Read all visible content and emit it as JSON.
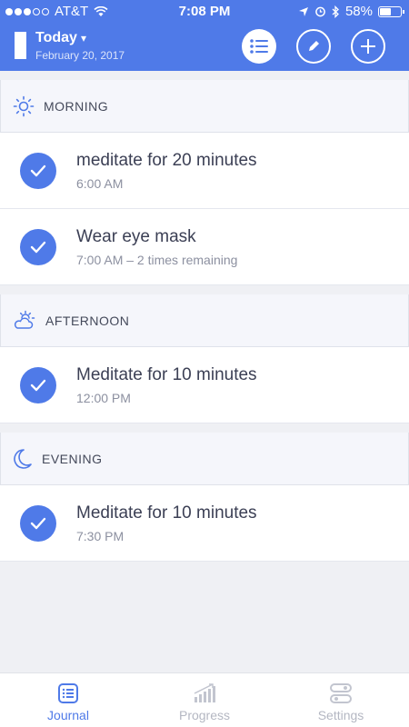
{
  "status": {
    "carrier": "AT&T",
    "time": "7:08 PM",
    "battery": "58%",
    "battery_level": 0.58
  },
  "header": {
    "title": "Today",
    "dropdown_glyph": "▾",
    "date": "February 20, 2017",
    "buttons": [
      "list-icon",
      "edit-icon",
      "add-icon"
    ]
  },
  "sections": [
    {
      "title": "MORNING",
      "icon": "sun-icon",
      "items": [
        {
          "title": "meditate for 20 minutes",
          "sub": "6:00 AM"
        },
        {
          "title": "Wear eye mask",
          "sub": "7:00 AM – 2 times remaining"
        }
      ]
    },
    {
      "title": "AFTERNOON",
      "icon": "partly-cloudy-icon",
      "items": [
        {
          "title": "Meditate for 10 minutes",
          "sub": "12:00 PM"
        }
      ]
    },
    {
      "title": "EVENING",
      "icon": "moon-icon",
      "items": [
        {
          "title": "Meditate for 10 minutes",
          "sub": "7:30 PM"
        }
      ]
    }
  ],
  "tabs": [
    {
      "label": "Journal",
      "icon": "journal-icon",
      "active": true
    },
    {
      "label": "Progress",
      "icon": "progress-icon",
      "active": false
    },
    {
      "label": "Settings",
      "icon": "settings-icon",
      "active": false
    }
  ],
  "colors": {
    "accent": "#4f7ae8",
    "background": "#eff0f4"
  }
}
